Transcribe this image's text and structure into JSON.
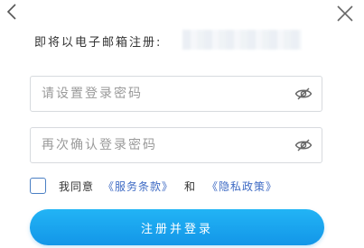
{
  "icons": {
    "back": "chevron-left-icon",
    "close": "close-icon",
    "password_toggle": "eye-off-icon",
    "checkbox": "checkbox-unchecked"
  },
  "register": {
    "prompt_label": "即将以电子邮箱注册:",
    "password_placeholder": "请设置登录密码",
    "confirm_placeholder": "再次确认登录密码",
    "agree_prefix": "我同意",
    "terms_link": "《服务条款》",
    "and_text": "和",
    "privacy_link": "《隐私政策》",
    "submit_label": "注册并登录"
  },
  "colors": {
    "accent": "#1396e8",
    "link": "#3f6bc4"
  }
}
